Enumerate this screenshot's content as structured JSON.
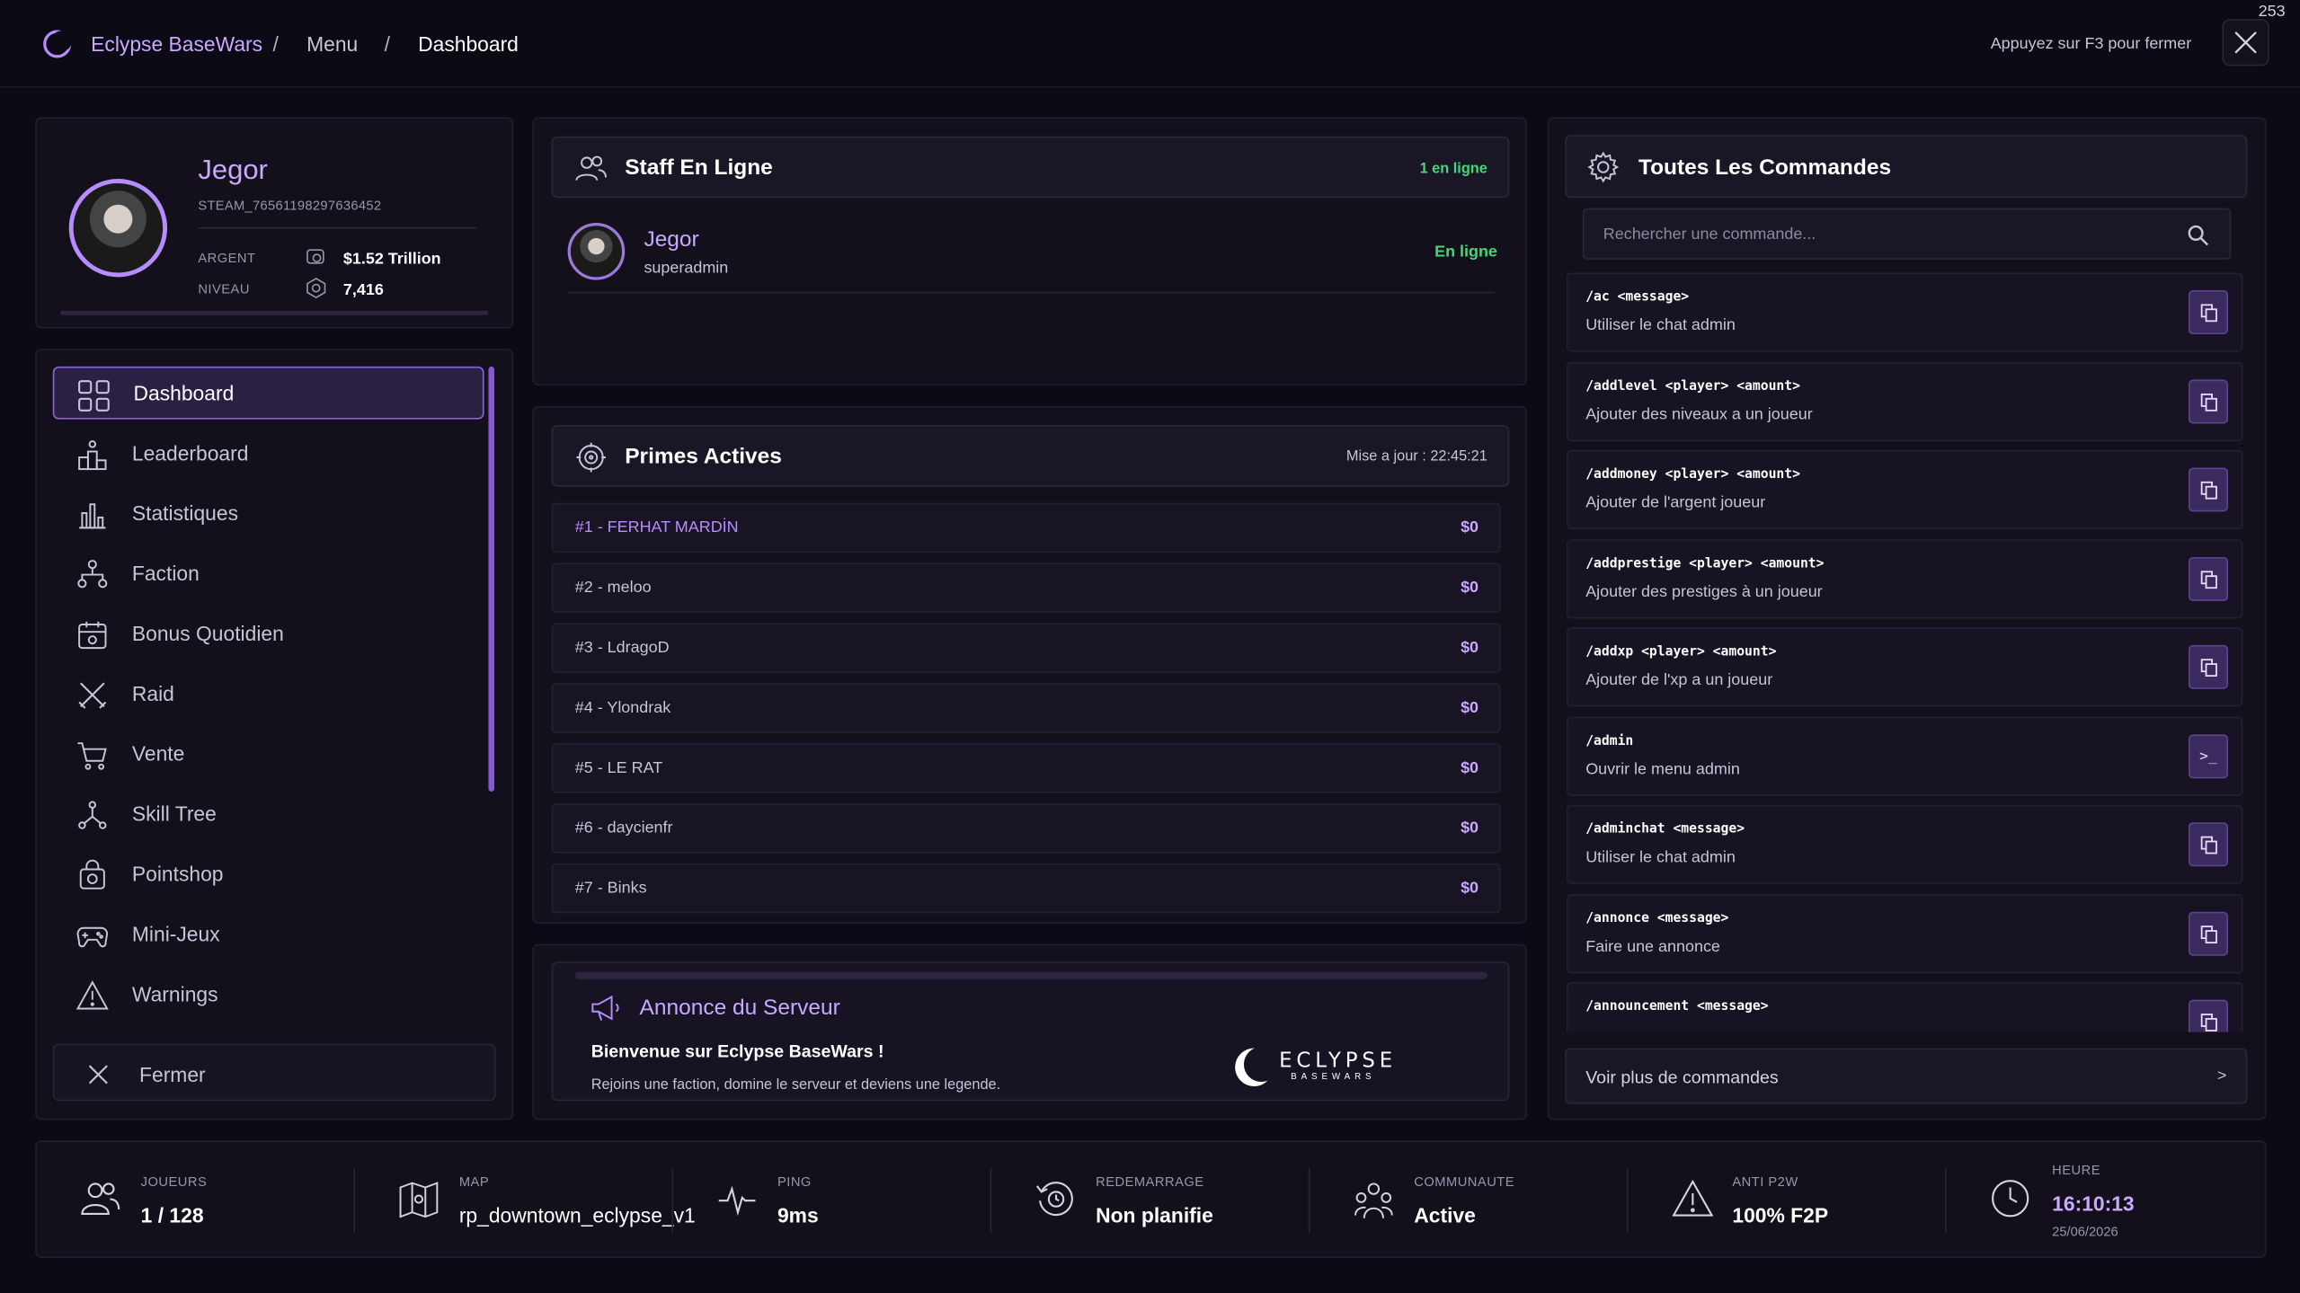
{
  "topbar": {
    "app_name": "Eclypse BaseWars",
    "sep1": "/",
    "menu": "Menu",
    "sep2": "/",
    "current": "Dashboard",
    "hint": "Appuyez sur F3 pour fermer",
    "corner_number": "253"
  },
  "profile": {
    "name": "Jegor",
    "steam_id": "STEAM_76561198297636452",
    "money_label": "ARGENT",
    "money_value": "$1.52 Trillion",
    "level_label": "NIVEAU",
    "level_value": "7,416"
  },
  "sidebar": {
    "items": [
      {
        "label": "Dashboard",
        "icon": "grid-icon"
      },
      {
        "label": "Leaderboard",
        "icon": "podium-icon"
      },
      {
        "label": "Statistiques",
        "icon": "bar-chart-icon"
      },
      {
        "label": "Faction",
        "icon": "hierarchy-icon"
      },
      {
        "label": "Bonus Quotidien",
        "icon": "calendar-icon"
      },
      {
        "label": "Raid",
        "icon": "crossed-swords-icon"
      },
      {
        "label": "Vente",
        "icon": "cart-icon"
      },
      {
        "label": "Skill Tree",
        "icon": "tree-icon"
      },
      {
        "label": "Pointshop",
        "icon": "shop-bag-icon"
      },
      {
        "label": "Mini-Jeux",
        "icon": "gamepad-icon"
      },
      {
        "label": "Warnings",
        "icon": "warning-icon"
      }
    ],
    "close_label": "Fermer"
  },
  "staff": {
    "title": "Staff En Ligne",
    "count": "1 en ligne",
    "members": [
      {
        "name": "Jegor",
        "role": "superadmin",
        "status": "En ligne"
      }
    ]
  },
  "bounties": {
    "title": "Primes Actives",
    "updated": "Mise a jour : 22:45:21",
    "rows": [
      {
        "name": "#1 - FERHAT MARDİN",
        "value": "$0"
      },
      {
        "name": "#2 - meloo",
        "value": "$0"
      },
      {
        "name": "#3 - LdragoD",
        "value": "$0"
      },
      {
        "name": "#4 - Ylondrak",
        "value": "$0"
      },
      {
        "name": "#5 - LE RAT",
        "value": "$0"
      },
      {
        "name": "#6 - daycienfr",
        "value": "$0"
      },
      {
        "name": "#7 - Binks",
        "value": "$0"
      }
    ]
  },
  "announcement": {
    "title": "Annonce du Serveur",
    "headline": "Bienvenue sur Eclypse BaseWars !",
    "body": "Rejoins une faction, domine le serveur et deviens une legende.",
    "logo_text": "ECLYPSE",
    "logo_sub": "BASEWARS"
  },
  "commands": {
    "title": "Toutes Les Commandes",
    "search_placeholder": "Rechercher une commande...",
    "items": [
      {
        "cmd": "/ac <message>",
        "desc": "Utiliser le chat admin",
        "action": "copy"
      },
      {
        "cmd": "/addlevel <player> <amount>",
        "desc": "Ajouter des niveaux a un joueur",
        "action": "copy"
      },
      {
        "cmd": "/addmoney <player> <amount>",
        "desc": "Ajouter de l'argent joueur",
        "action": "copy"
      },
      {
        "cmd": "/addprestige <player> <amount>",
        "desc": "Ajouter des prestiges à un joueur",
        "action": "copy"
      },
      {
        "cmd": "/addxp <player> <amount>",
        "desc": "Ajouter de l'xp a un joueur",
        "action": "copy"
      },
      {
        "cmd": "/admin",
        "desc": "Ouvrir le menu admin",
        "action": ">_"
      },
      {
        "cmd": "/adminchat <message>",
        "desc": "Utiliser le chat admin",
        "action": "copy"
      },
      {
        "cmd": "/annonce <message>",
        "desc": "Faire une annonce",
        "action": "copy"
      },
      {
        "cmd": "/announcement <message>",
        "desc": "",
        "action": "copy"
      }
    ],
    "more_label": "Voir plus de commandes",
    "more_arrow": ">"
  },
  "stats": {
    "players_label": "JOUEURS",
    "players_value": "1 / 128",
    "map_label": "MAP",
    "map_value": "rp_downtown_eclypse_v1",
    "ping_label": "PING",
    "ping_value": "9ms",
    "restart_label": "REDEMARRAGE",
    "restart_value": "Non planifie",
    "community_label": "COMMUNAUTE",
    "community_value": "Active",
    "antip2w_label": "ANTI P2W",
    "antip2w_value": "100% F2P",
    "time_label": "HEURE",
    "time_value": "16:10:13",
    "date_value": "25/06/2026"
  },
  "colors": {
    "accent": "#b68cff",
    "online": "#46d67a",
    "background": "#0c0a14"
  }
}
